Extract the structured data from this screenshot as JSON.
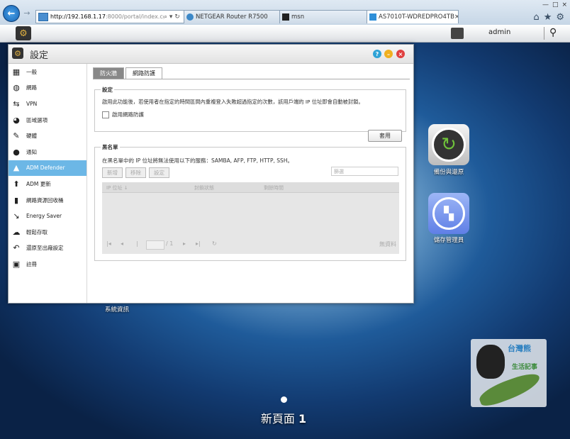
{
  "browser": {
    "url_prefix": "http://192.168.1.17",
    "url_rest": ":8000/portal/index.cgi",
    "url_tools": "⌕ ▾ ↻",
    "tabs": [
      {
        "label": "NETGEAR Router R7500"
      },
      {
        "label": "msn"
      },
      {
        "label": "AS7010T-WDREDPRO4TB",
        "close": "×"
      }
    ],
    "window_controls": {
      "minimize": "—",
      "maximize": "□",
      "close": "×"
    },
    "toolbar_icons": {
      "home": "⌂",
      "favorites": "★",
      "tools": "⚙"
    }
  },
  "taskbar": {
    "user": "admin"
  },
  "window": {
    "title": "設定",
    "controls": {
      "help": "?",
      "minimize": "–",
      "close": "×"
    }
  },
  "sidebar": {
    "items": [
      {
        "label": "一般",
        "icon": "general-icon",
        "glyph": "▦"
      },
      {
        "label": "網路",
        "icon": "network-globe-icon",
        "glyph": "◍"
      },
      {
        "label": "VPN",
        "icon": "vpn-icon",
        "glyph": "⇆"
      },
      {
        "label": "區域選項",
        "icon": "region-globe-icon",
        "glyph": "◕"
      },
      {
        "label": "硬體",
        "icon": "hardware-icon",
        "glyph": "✎"
      },
      {
        "label": "通知",
        "icon": "notification-icon",
        "glyph": "●"
      },
      {
        "label": "ADM Defender",
        "icon": "defender-icon",
        "glyph": "▲"
      },
      {
        "label": "ADM 更新",
        "icon": "update-arrow-icon",
        "glyph": "⬆"
      },
      {
        "label": "網路資源回收桶",
        "icon": "recycle-bin-icon",
        "glyph": "▮"
      },
      {
        "label": "Energy Saver",
        "icon": "energy-saver-icon",
        "glyph": "↘"
      },
      {
        "label": "輕鬆存取",
        "icon": "cloud-access-icon",
        "glyph": "☁"
      },
      {
        "label": "還原至出廠設定",
        "icon": "restore-icon",
        "glyph": "↶"
      },
      {
        "label": "註冊",
        "icon": "register-icon",
        "glyph": "▣"
      }
    ],
    "active_index": 6
  },
  "tabs": {
    "firewall": "防火牆",
    "network_defender": "網路防護"
  },
  "settings": {
    "legend": "設定",
    "description": "啟用此功能後，若使用者在指定的時間區間內重複登入失敗超過指定的次數，該用戶端的 IP 位址即會自動被封鎖。",
    "checkbox_label": "啟用網路防護",
    "checkbox_checked": false
  },
  "apply_label": "套用",
  "blacklist": {
    "legend": "黑名單",
    "description": "在黑名單中的 IP 位址將無法使用以下的服務：SAMBA, AFP, FTP, HTTP, SSH。",
    "add_label": "新增",
    "remove_label": "移除",
    "settings_label": "設定",
    "search_placeholder": "篩選",
    "columns": [
      "IP 位址 ↓",
      "封鎖狀態",
      "剩餘時間"
    ],
    "pager": {
      "first": "|◂",
      "prev": "◂",
      "page_sep": "/ 1",
      "next": "▸",
      "last": "▸|",
      "refresh": "↻",
      "no_data": "無資料"
    }
  },
  "desktop": {
    "icons": [
      {
        "label": "備份與還原"
      },
      {
        "label": "儲存管理員"
      }
    ],
    "sysinfo_label": "系統資訊",
    "page_label_text": "新頁面 ",
    "page_number": "1"
  },
  "watermark": {
    "text1": "台灣熊",
    "text2": "生活記事"
  },
  "colors": {
    "active_sidebar": "#6cb7e6",
    "help_button": "#2fa3d6",
    "minimize_button": "#f0b020",
    "close_button": "#e04040"
  }
}
